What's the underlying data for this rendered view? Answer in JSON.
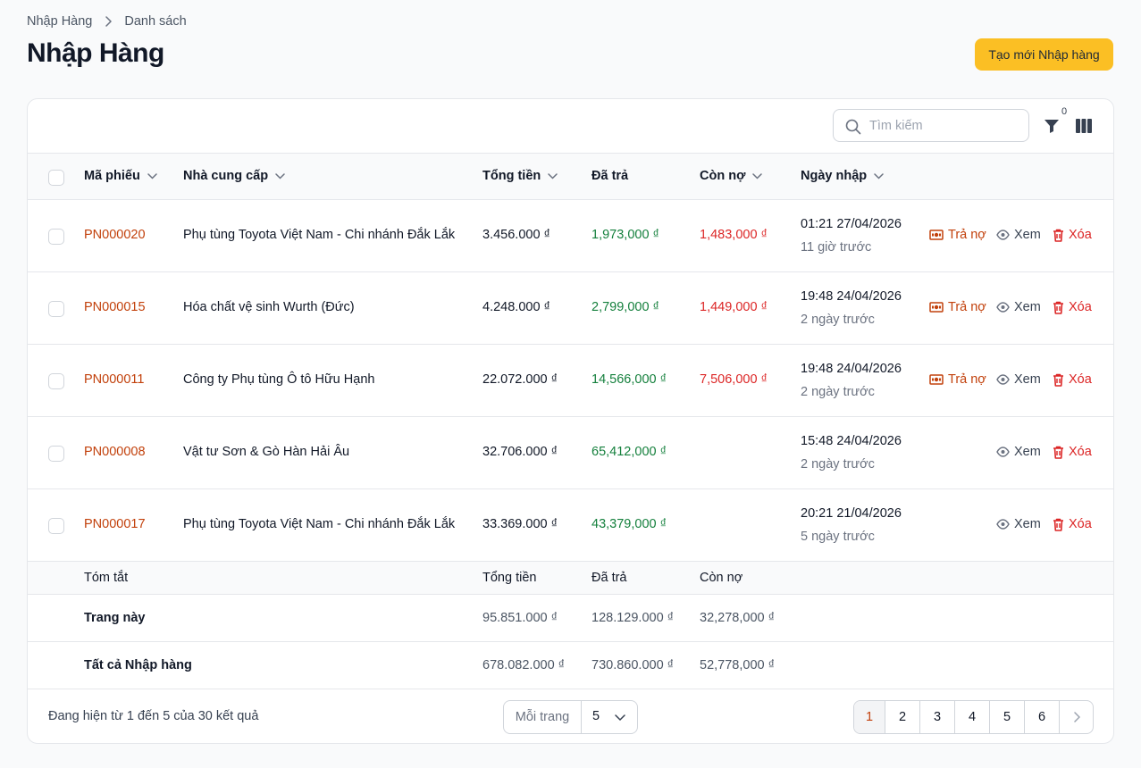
{
  "breadcrumb": {
    "root": "Nhập Hàng",
    "current": "Danh sách"
  },
  "page": {
    "title": "Nhập Hàng",
    "create_label": "Tạo mới Nhập hàng"
  },
  "toolbar": {
    "search_placeholder": "Tìm kiếm",
    "filter_count": "0"
  },
  "columns": {
    "code": "Mã phiếu",
    "supplier": "Nhà cung cấp",
    "total": "Tổng tiền",
    "paid": "Đã trả",
    "debt": "Còn nợ",
    "date": "Ngày nhập"
  },
  "rows": [
    {
      "code": "PN000020",
      "supplier": "Phụ tùng Toyota Việt Nam - Chi nhánh Đắk Lắk",
      "total": "3.456.000 ₫",
      "paid": "1,973,000 ₫",
      "debt": "1,483,000 ₫",
      "date": "01:21 27/04/2026",
      "relative": "11 giờ trước",
      "pay_label": "Trả nợ",
      "view_label": "Xem",
      "delete_label": "Xóa"
    },
    {
      "code": "PN000015",
      "supplier": "Hóa chất vệ sinh Wurth (Đức)",
      "total": "4.248.000 ₫",
      "paid": "2,799,000 ₫",
      "debt": "1,449,000 ₫",
      "date": "19:48 24/04/2026",
      "relative": "2 ngày trước",
      "pay_label": "Trả nợ",
      "view_label": "Xem",
      "delete_label": "Xóa"
    },
    {
      "code": "PN000011",
      "supplier": "Công ty Phụ tùng Ô tô Hữu Hạnh",
      "total": "22.072.000 ₫",
      "paid": "14,566,000 ₫",
      "debt": "7,506,000 ₫",
      "date": "19:48 24/04/2026",
      "relative": "2 ngày trước",
      "pay_label": "Trả nợ",
      "view_label": "Xem",
      "delete_label": "Xóa"
    },
    {
      "code": "PN000008",
      "supplier": "Vật tư Sơn & Gò Hàn Hải Âu",
      "total": "32.706.000 ₫",
      "paid": "65,412,000 ₫",
      "debt": "",
      "date": "15:48 24/04/2026",
      "relative": "2 ngày trước",
      "pay_label": "",
      "view_label": "Xem",
      "delete_label": "Xóa"
    },
    {
      "code": "PN000017",
      "supplier": "Phụ tùng Toyota Việt Nam - Chi nhánh Đắk Lắk",
      "total": "33.369.000 ₫",
      "paid": "43,379,000 ₫",
      "debt": "",
      "date": "20:21 21/04/2026",
      "relative": "5 ngày trước",
      "pay_label": "",
      "view_label": "Xem",
      "delete_label": "Xóa"
    }
  ],
  "summary": {
    "title": "Tóm tắt",
    "total_label": "Tổng tiền",
    "paid_label": "Đã trả",
    "debt_label": "Còn nợ",
    "this_page": {
      "label": "Trang này",
      "total": "95.851.000 ₫",
      "paid": "128.129.000 ₫",
      "debt": "32,278,000 ₫"
    },
    "all": {
      "label": "Tất cả Nhập hàng",
      "total": "678.082.000 ₫",
      "paid": "730.860.000 ₫",
      "debt": "52,778,000 ₫"
    }
  },
  "footer": {
    "result_text": "Đang hiện từ 1 đến 5 của 30 kết quả",
    "per_page_label": "Mỗi trang",
    "per_page_value": "5",
    "pages": [
      "1",
      "2",
      "3",
      "4",
      "5",
      "6"
    ],
    "current_page": "1"
  },
  "colors": {
    "accent": "#fbbf24",
    "code": "#c2410c",
    "paid": "#15803d",
    "debt": "#dc2626"
  }
}
